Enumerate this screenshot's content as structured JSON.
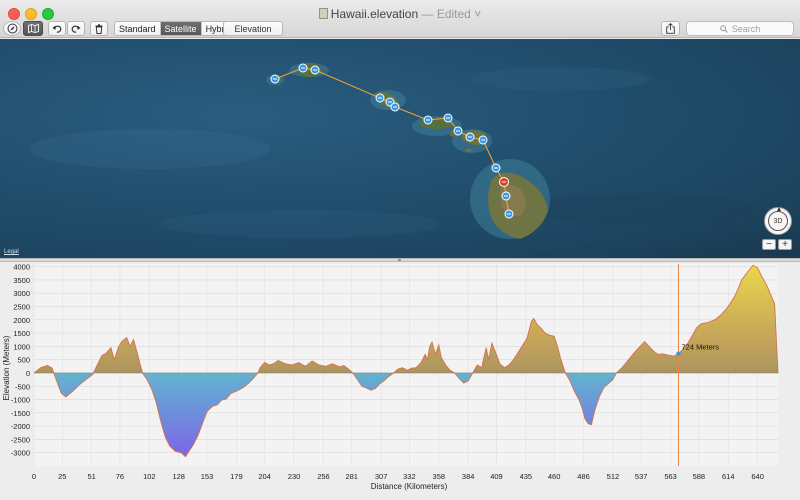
{
  "window": {
    "title": "Hawaii.elevation",
    "status": "— Edited",
    "chevron": "˅"
  },
  "toolbar": {
    "icons": [
      "compass-icon",
      "map-icon",
      "undo-icon",
      "redo-icon",
      "trash-icon",
      "share-icon",
      "search-icon"
    ],
    "map_types": [
      "Standard",
      "Satellite",
      "Hybrid"
    ],
    "selected_map_type": "Satellite",
    "elevation_label": "Elevation",
    "search_placeholder": "Search"
  },
  "map": {
    "legal": "Legal",
    "compass_label": "3D",
    "zoom_out": "−",
    "zoom_in": "+",
    "route_color": "#f0a030",
    "selected_pin_color": "#e0402a",
    "pin_color": "#3a97e6",
    "pins": 18
  },
  "chart_data": {
    "type": "area",
    "xlabel": "Distance (Kilometers)",
    "ylabel": "Elevation (Meters)",
    "xlim": [
      0,
      658
    ],
    "ylim": [
      -3500,
      4100
    ],
    "x_ticks": [
      0,
      25,
      51,
      76,
      102,
      128,
      153,
      179,
      204,
      230,
      256,
      281,
      307,
      332,
      358,
      384,
      409,
      435,
      460,
      486,
      512,
      537,
      563,
      588,
      614,
      640
    ],
    "y_ticks": [
      4000,
      3500,
      3000,
      2500,
      2000,
      1500,
      1000,
      500,
      0,
      -500,
      -1000,
      -1500,
      -2000,
      -2500,
      -3000
    ],
    "grid": true,
    "cursor": {
      "x": 570,
      "value_label": "724 Meters"
    },
    "profile": [
      [
        0,
        0
      ],
      [
        6,
        200
      ],
      [
        12,
        280
      ],
      [
        16,
        180
      ],
      [
        20,
        -300
      ],
      [
        24,
        -750
      ],
      [
        28,
        -900
      ],
      [
        34,
        -700
      ],
      [
        40,
        -450
      ],
      [
        46,
        -250
      ],
      [
        52,
        -50
      ],
      [
        56,
        300
      ],
      [
        60,
        650
      ],
      [
        64,
        750
      ],
      [
        68,
        950
      ],
      [
        71,
        500
      ],
      [
        75,
        1000
      ],
      [
        78,
        1200
      ],
      [
        82,
        1330
      ],
      [
        85,
        1000
      ],
      [
        88,
        1260
      ],
      [
        91,
        800
      ],
      [
        94,
        300
      ],
      [
        96,
        0
      ],
      [
        100,
        -250
      ],
      [
        104,
        -600
      ],
      [
        108,
        -1100
      ],
      [
        112,
        -1800
      ],
      [
        116,
        -2400
      ],
      [
        120,
        -2750
      ],
      [
        125,
        -2950
      ],
      [
        130,
        -3000
      ],
      [
        134,
        -3150
      ],
      [
        137,
        -2950
      ],
      [
        141,
        -2700
      ],
      [
        145,
        -2350
      ],
      [
        149,
        -1900
      ],
      [
        153,
        -1450
      ],
      [
        158,
        -1250
      ],
      [
        162,
        -1200
      ],
      [
        166,
        -1020
      ],
      [
        170,
        -980
      ],
      [
        174,
        -780
      ],
      [
        178,
        -700
      ],
      [
        182,
        -620
      ],
      [
        186,
        -520
      ],
      [
        190,
        -380
      ],
      [
        194,
        -200
      ],
      [
        198,
        0
      ],
      [
        200,
        200
      ],
      [
        204,
        400
      ],
      [
        208,
        300
      ],
      [
        212,
        350
      ],
      [
        216,
        470
      ],
      [
        222,
        350
      ],
      [
        228,
        300
      ],
      [
        234,
        390
      ],
      [
        240,
        250
      ],
      [
        246,
        450
      ],
      [
        252,
        300
      ],
      [
        258,
        250
      ],
      [
        264,
        350
      ],
      [
        270,
        230
      ],
      [
        274,
        280
      ],
      [
        278,
        150
      ],
      [
        282,
        0
      ],
      [
        286,
        -250
      ],
      [
        290,
        -500
      ],
      [
        294,
        -560
      ],
      [
        298,
        -650
      ],
      [
        302,
        -580
      ],
      [
        306,
        -400
      ],
      [
        310,
        -280
      ],
      [
        314,
        -120
      ],
      [
        318,
        0
      ],
      [
        322,
        150
      ],
      [
        326,
        200
      ],
      [
        330,
        100
      ],
      [
        334,
        180
      ],
      [
        338,
        200
      ],
      [
        342,
        380
      ],
      [
        346,
        700
      ],
      [
        348,
        500
      ],
      [
        350,
        990
      ],
      [
        352,
        1160
      ],
      [
        355,
        700
      ],
      [
        358,
        1050
      ],
      [
        360,
        600
      ],
      [
        364,
        300
      ],
      [
        368,
        100
      ],
      [
        372,
        0
      ],
      [
        376,
        -200
      ],
      [
        380,
        -380
      ],
      [
        384,
        -300
      ],
      [
        388,
        0
      ],
      [
        392,
        300
      ],
      [
        396,
        200
      ],
      [
        398,
        600
      ],
      [
        400,
        950
      ],
      [
        402,
        500
      ],
      [
        405,
        1120
      ],
      [
        408,
        800
      ],
      [
        412,
        350
      ],
      [
        416,
        200
      ],
      [
        420,
        300
      ],
      [
        424,
        500
      ],
      [
        430,
        900
      ],
      [
        436,
        1300
      ],
      [
        440,
        1950
      ],
      [
        442,
        2050
      ],
      [
        445,
        1820
      ],
      [
        448,
        1700
      ],
      [
        452,
        1500
      ],
      [
        456,
        1420
      ],
      [
        460,
        1380
      ],
      [
        463,
        1000
      ],
      [
        466,
        500
      ],
      [
        470,
        0
      ],
      [
        474,
        -300
      ],
      [
        478,
        -700
      ],
      [
        482,
        -1000
      ],
      [
        485,
        -1350
      ],
      [
        487,
        -1700
      ],
      [
        490,
        -1900
      ],
      [
        493,
        -1950
      ],
      [
        496,
        -1400
      ],
      [
        500,
        -900
      ],
      [
        504,
        -550
      ],
      [
        508,
        -400
      ],
      [
        512,
        -250
      ],
      [
        515,
        0
      ],
      [
        520,
        200
      ],
      [
        524,
        400
      ],
      [
        528,
        620
      ],
      [
        532,
        820
      ],
      [
        536,
        1000
      ],
      [
        540,
        1180
      ],
      [
        544,
        1000
      ],
      [
        548,
        820
      ],
      [
        552,
        700
      ],
      [
        556,
        720
      ],
      [
        560,
        680
      ],
      [
        566,
        630
      ],
      [
        570,
        724
      ],
      [
        574,
        900
      ],
      [
        578,
        1100
      ],
      [
        582,
        1400
      ],
      [
        586,
        1700
      ],
      [
        590,
        1850
      ],
      [
        596,
        1900
      ],
      [
        602,
        2000
      ],
      [
        608,
        2200
      ],
      [
        614,
        2500
      ],
      [
        620,
        2900
      ],
      [
        626,
        3500
      ],
      [
        632,
        3850
      ],
      [
        636,
        4050
      ],
      [
        640,
        3950
      ],
      [
        644,
        3600
      ],
      [
        648,
        3300
      ],
      [
        652,
        2900
      ],
      [
        655,
        2600
      ],
      [
        658,
        0
      ]
    ]
  }
}
